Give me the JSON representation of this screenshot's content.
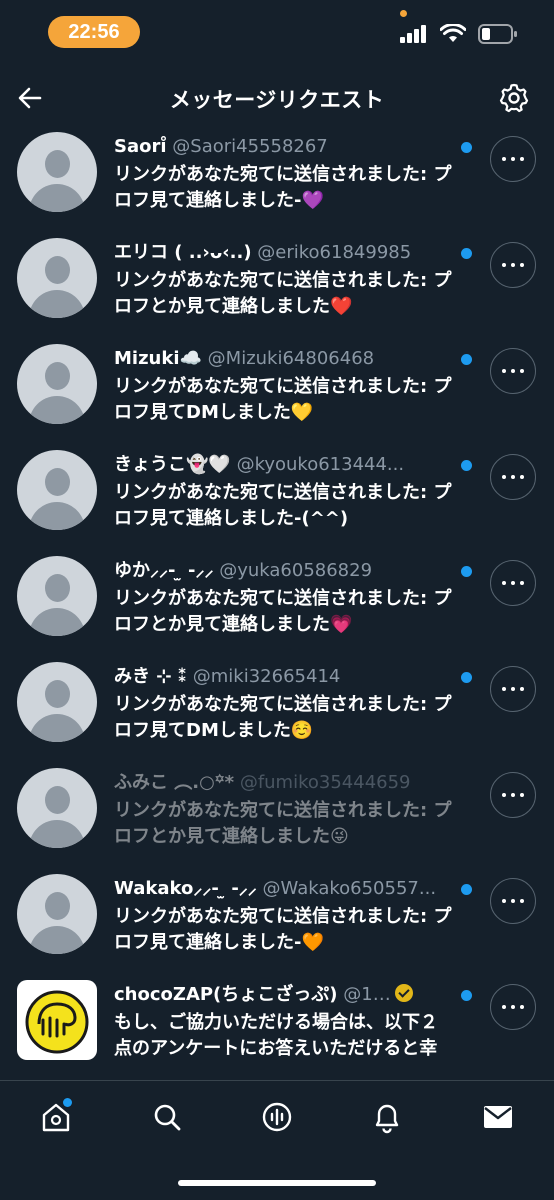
{
  "status_bar": {
    "time": "22:56"
  },
  "header": {
    "title": "メッセージリクエスト"
  },
  "requests": [
    {
      "name": "Saori̊",
      "handle": "@Saori45558267",
      "message": "リンクがあなた宛てに送信されました: プロフ見て連絡しました-💜",
      "avatar": "default",
      "unread": true,
      "muted": false
    },
    {
      "name": "エリコ ( ..›ᴗ‹..)",
      "handle": "@eriko61849985",
      "message": "リンクがあなた宛てに送信されました: プロフとか見て連絡しました❤️",
      "avatar": "default",
      "unread": true,
      "muted": false
    },
    {
      "name": "Mizuki☁️",
      "handle": "@Mizuki64806468",
      "message": "リンクがあなた宛てに送信されました: プロフ見てDMしました💛",
      "avatar": "default",
      "unread": true,
      "muted": false
    },
    {
      "name": "きょうこ👻🤍",
      "handle": "@kyouko613444...",
      "message": "リンクがあなた宛てに送信されました: プロフ見て連絡しました-(^^)",
      "avatar": "default",
      "unread": true,
      "muted": false
    },
    {
      "name": "ゆか⸝⸝- ̫ -⸝⸝",
      "handle": "@yuka60586829",
      "message": "リンクがあなた宛てに送信されました: プロフとか見て連絡しました💗",
      "avatar": "default",
      "unread": true,
      "muted": false
    },
    {
      "name": "みき ⊹ ⁑",
      "handle": "@miki32665414",
      "message": "リンクがあなた宛てに送信されました: プロフ見てDMしました☺️",
      "avatar": "default",
      "unread": true,
      "muted": false
    },
    {
      "name": "ふみこ ︵.○꙳*",
      "handle": "@fumiko35444659",
      "message": "リンクがあなた宛てに送信されました: プロフとか見て連絡しました😜",
      "avatar": "default",
      "unread": false,
      "muted": true
    },
    {
      "name": "Wakako⸝⸝- ̫ -⸝⸝",
      "handle": "@Wakako650557...",
      "message": "リンクがあなた宛てに送信されました: プロフ見て連絡しました-🧡",
      "avatar": "default",
      "unread": true,
      "muted": false
    },
    {
      "name": "chocoZAP(ちょこざっぷ)",
      "handle": "@1…",
      "message": "もし、ご協力いただける場合は、以下２点のアンケートにお答えいただけると幸",
      "avatar": "logo",
      "unread": true,
      "muted": false,
      "verified": true
    }
  ],
  "colors": {
    "background": "#15202b",
    "accent": "#1d9bf0",
    "time_pill": "#f5a53a",
    "secondary_text": "#8b98a5"
  }
}
